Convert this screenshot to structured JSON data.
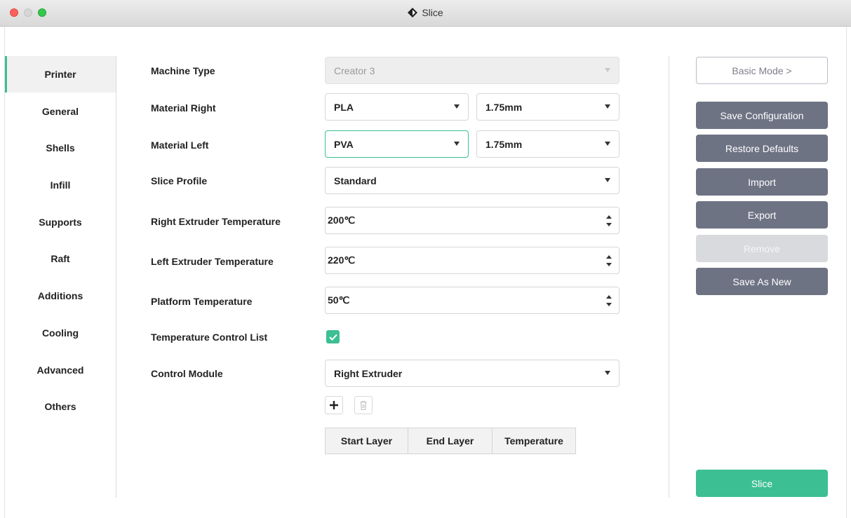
{
  "window": {
    "title": "Slice"
  },
  "sidebar": {
    "items": [
      {
        "label": "Printer",
        "active": true
      },
      {
        "label": "General"
      },
      {
        "label": "Shells"
      },
      {
        "label": "Infill"
      },
      {
        "label": "Supports"
      },
      {
        "label": "Raft"
      },
      {
        "label": "Additions"
      },
      {
        "label": "Cooling"
      },
      {
        "label": "Advanced"
      },
      {
        "label": "Others"
      }
    ]
  },
  "form": {
    "machine_type": {
      "label": "Machine Type",
      "value": "Creator 3"
    },
    "material_right": {
      "label": "Material Right",
      "value": "PLA",
      "diameter": "1.75mm"
    },
    "material_left": {
      "label": "Material Left",
      "value": "PVA",
      "diameter": "1.75mm"
    },
    "slice_profile": {
      "label": "Slice Profile",
      "value": "Standard"
    },
    "right_extruder_temp": {
      "label": "Right Extruder Temperature",
      "value": "200℃"
    },
    "left_extruder_temp": {
      "label": "Left Extruder Temperature",
      "value": "220℃"
    },
    "platform_temp": {
      "label": "Platform Temperature",
      "value": "50℃"
    },
    "temp_control_list": {
      "label": "Temperature Control List",
      "checked": true
    },
    "control_module": {
      "label": "Control Module",
      "value": "Right Extruder"
    },
    "table": {
      "columns": [
        "Start Layer",
        "End Layer",
        "Temperature"
      ]
    }
  },
  "actions": {
    "basic_mode": "Basic Mode >",
    "save_configuration": "Save Configuration",
    "restore_defaults": "Restore Defaults",
    "import": "Import",
    "export": "Export",
    "remove": "Remove",
    "save_as_new": "Save As New",
    "slice": "Slice"
  },
  "colors": {
    "accent": "#3cbf92",
    "button": "#6e7384",
    "disabled": "#d9dadd"
  }
}
